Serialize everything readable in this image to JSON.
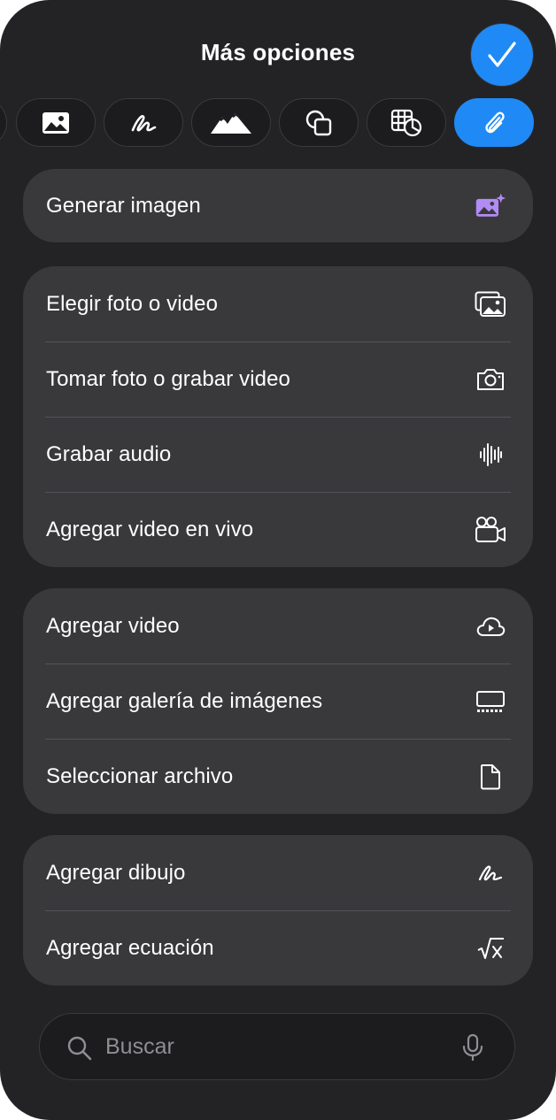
{
  "header": {
    "title": "Más opciones",
    "done_icon": "checkmark-icon"
  },
  "tabs": [
    {
      "name": "image-icon",
      "active": false
    },
    {
      "name": "drawing-icon",
      "active": false
    },
    {
      "name": "landscape-icon",
      "active": false
    },
    {
      "name": "shapes-icon",
      "active": false
    },
    {
      "name": "table-chart-icon",
      "active": false
    },
    {
      "name": "paperclip-icon",
      "active": true
    }
  ],
  "groups": [
    {
      "rows": [
        {
          "label": "Generar imagen",
          "icon": "sparkle-image-icon"
        }
      ]
    },
    {
      "rows": [
        {
          "label": "Elegir foto o video",
          "icon": "photo-library-icon"
        },
        {
          "label": "Tomar foto o grabar video",
          "icon": "camera-icon"
        },
        {
          "label": "Grabar audio",
          "icon": "waveform-icon"
        },
        {
          "label": "Agregar video en vivo",
          "icon": "video-camera-icon"
        }
      ]
    },
    {
      "rows": [
        {
          "label": "Agregar video",
          "icon": "cloud-play-icon"
        },
        {
          "label": "Agregar galería de imágenes",
          "icon": "gallery-icon"
        },
        {
          "label": "Seleccionar archivo",
          "icon": "document-icon"
        }
      ]
    },
    {
      "rows": [
        {
          "label": "Agregar dibujo",
          "icon": "scribble-icon"
        },
        {
          "label": "Agregar ecuación",
          "icon": "square-root-icon"
        }
      ]
    }
  ],
  "search": {
    "placeholder": "Buscar",
    "value": ""
  },
  "colors": {
    "sheet_background": "#232325",
    "group_background": "#39393c",
    "accent": "#1f8af5",
    "ai_icon": "#b28cf5"
  }
}
